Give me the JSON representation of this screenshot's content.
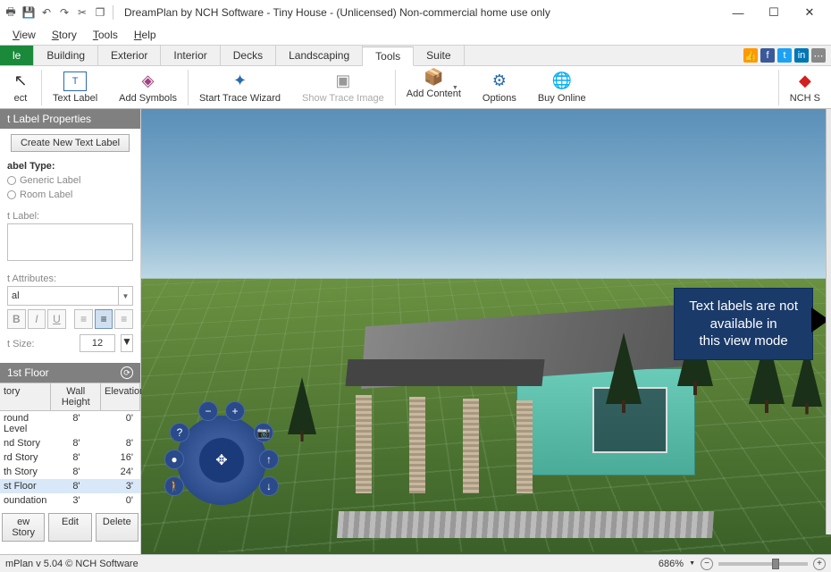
{
  "title": "DreamPlan by NCH Software - Tiny House - (Unlicensed) Non-commercial home use only",
  "menus": [
    "View",
    "Story",
    "Tools",
    "Help"
  ],
  "tabs": {
    "file": "le",
    "items": [
      "Building",
      "Exterior",
      "Interior",
      "Decks",
      "Landscaping",
      "Tools",
      "Suite"
    ],
    "active": "Tools"
  },
  "ribbon": {
    "select": "ect",
    "textlabel": "Text Label",
    "addsymbols": "Add Symbols",
    "starttrace": "Start Trace Wizard",
    "showtrace": "Show Trace Image",
    "addcontent": "Add Content",
    "options": "Options",
    "buyonline": "Buy Online",
    "nch": "NCH S"
  },
  "panel": {
    "header": "t Label Properties",
    "newbtn": "Create New Text Label",
    "labeltype": "abel Type:",
    "generic": "Generic Label",
    "room": "Room Label",
    "textlabel": "t Label:",
    "textattr": "t Attributes:",
    "font": "al",
    "fontsize_lbl": "t Size:",
    "fontsize": "12"
  },
  "story": {
    "header": "1st Floor",
    "cols": [
      "tory",
      "Wall Height",
      "Elevation"
    ],
    "rows": [
      {
        "n": "round Level",
        "h": "8'",
        "e": "0'"
      },
      {
        "n": "nd Story",
        "h": "8'",
        "e": "8'"
      },
      {
        "n": "rd Story",
        "h": "8'",
        "e": "16'"
      },
      {
        "n": "th Story",
        "h": "8'",
        "e": "24'"
      },
      {
        "n": "st Floor",
        "h": "8'",
        "e": "3'",
        "sel": true
      },
      {
        "n": "oundation",
        "h": "3'",
        "e": "0'"
      }
    ],
    "btns": {
      "new": "ew Story",
      "edit": "Edit",
      "del": "Delete"
    }
  },
  "tooltip": "Text labels are not\navailable in\nthis view mode",
  "status": {
    "left": "mPlan v 5.04 © NCH Software",
    "zoom": "686%"
  }
}
